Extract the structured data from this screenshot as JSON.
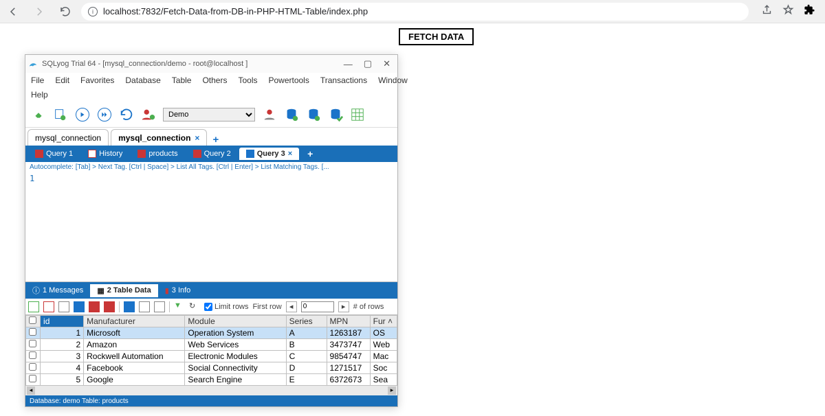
{
  "browser": {
    "url": "localhost:7832/Fetch-Data-from-DB-in-PHP-HTML-Table/index.php"
  },
  "page": {
    "fetch_button": "FETCH DATA"
  },
  "sqlyog": {
    "title": "SQLyog Trial 64 - [mysql_connection/demo - root@localhost ]",
    "menu": [
      "File",
      "Edit",
      "Favorites",
      "Database",
      "Table",
      "Others",
      "Tools",
      "Powertools",
      "Transactions",
      "Window"
    ],
    "menu2": "Help",
    "db_select": "Demo",
    "conn_tabs": {
      "inactive": "mysql_connection",
      "active": "mysql_connection"
    },
    "query_tabs": {
      "q1": "Query 1",
      "history": "History",
      "products": "products",
      "q2": "Query 2",
      "q3": "Query 3"
    },
    "hint": "Autocomplete: [Tab] > Next Tag. [Ctrl | Space] > List All Tags. [Ctrl | Enter] > List Matching Tags. [...",
    "editor_line": "1",
    "result_tabs": {
      "msg": "1 Messages",
      "data": "2 Table Data",
      "info": "3 Info"
    },
    "res_toolbar": {
      "limit": "Limit rows",
      "first": "First row",
      "value": "0",
      "count": "# of rows"
    },
    "grid": {
      "headers": [
        "id",
        "Manufacturer",
        "Module",
        "Series",
        "MPN",
        "Fur"
      ],
      "rows": [
        {
          "id": "1",
          "man": "Microsoft",
          "mod": "Operation System",
          "ser": "A",
          "mpn": "1263187",
          "fur": "OS"
        },
        {
          "id": "2",
          "man": "Amazon",
          "mod": "Web Services",
          "ser": "B",
          "mpn": "3473747",
          "fur": "Web"
        },
        {
          "id": "3",
          "man": "Rockwell Automation",
          "mod": "Electronic Modules",
          "ser": "C",
          "mpn": "9854747",
          "fur": "Mac"
        },
        {
          "id": "4",
          "man": "Facebook",
          "mod": "Social Connectivity",
          "ser": "D",
          "mpn": "1271517",
          "fur": "Soc"
        },
        {
          "id": "5",
          "man": "Google",
          "mod": "Search Engine",
          "ser": "E",
          "mpn": "6372673",
          "fur": "Sea"
        }
      ]
    },
    "status": "Database: demo   Table: products"
  }
}
